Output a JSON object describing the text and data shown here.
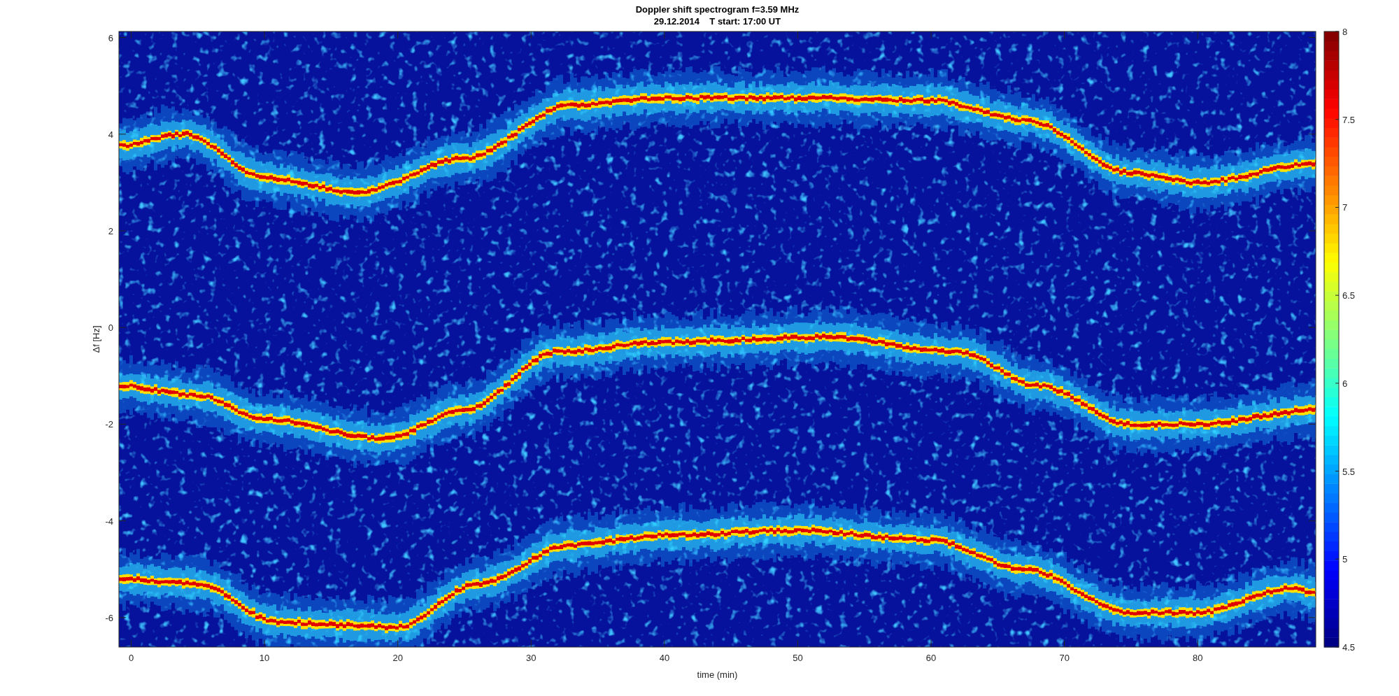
{
  "figure": {
    "title_lines": [
      "Doppler shift spectrogram f=3.59 MHz",
      "29.12.2014    T start: 17:00 UT"
    ]
  },
  "axes": {
    "xlabel": "time (min)",
    "ylabel": "Δf [Hz]",
    "xticks": [
      "0",
      "10",
      "20",
      "30",
      "40",
      "50",
      "60",
      "70",
      "80"
    ],
    "yticks": [
      "6",
      "4",
      "2",
      "0",
      "-2",
      "-4",
      "-6"
    ]
  },
  "colorbar": {
    "ticks": [
      "8",
      "7.5",
      "7",
      "6.5",
      "6",
      "5.5",
      "5",
      "4.5"
    ]
  }
}
